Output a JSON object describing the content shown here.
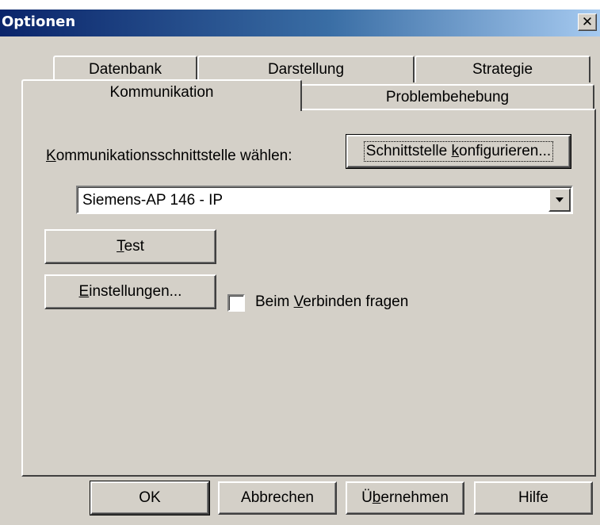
{
  "window": {
    "title": "Optionen",
    "close_symbol": "✕"
  },
  "tabs": {
    "row_back": [
      {
        "label": "Datenbank"
      },
      {
        "label": "Darstellung"
      },
      {
        "label": "Strategie"
      }
    ],
    "row_front": [
      {
        "label": "Kommunikation",
        "active": true
      },
      {
        "label": "Problembehebung",
        "active": false
      }
    ]
  },
  "panel": {
    "interface_label_mnemonic": "K",
    "interface_label_rest": "ommunikationsschnittstelle wählen:",
    "configure_button_pre": "Schnittstelle ",
    "configure_button_mnemonic": "k",
    "configure_button_post": "onfigurieren...",
    "interface_value": "Siemens-AP 146 - IP",
    "test_button_mnemonic": "T",
    "test_button_rest": "est",
    "settings_button_mnemonic": "E",
    "settings_button_rest": "instellungen...",
    "ask_checkbox_pre": "Beim ",
    "ask_checkbox_mnemonic": "V",
    "ask_checkbox_post": "erbinden fragen",
    "ask_checkbox_checked": false
  },
  "footer": {
    "ok_label": "OK",
    "cancel_label": "Abbrechen",
    "apply_mnemonic": "Ü",
    "apply_mnemonic_b": "b",
    "apply_rest": "ernehmen",
    "help_label": "Hilfe"
  },
  "colors": {
    "titlebar_start": "#0a246a",
    "titlebar_end": "#a6caf0",
    "face": "#d4d0c8"
  }
}
